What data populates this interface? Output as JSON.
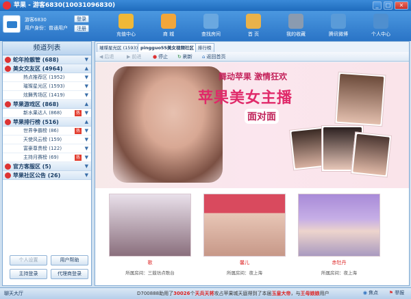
{
  "window": {
    "title": "苹果 - 游客6830(10031096830)"
  },
  "user": {
    "name": "游客6830",
    "identity": "用户身份：普通用户",
    "login_label": "登录",
    "register_label": "注册"
  },
  "nav": [
    {
      "label": "充值中心",
      "icon": "coin-icon",
      "color": "#f0b838"
    },
    {
      "label": "商 城",
      "icon": "cart-icon",
      "color": "#f2a63a"
    },
    {
      "label": "查找房间",
      "icon": "search-icon",
      "color": "#6aa8e0"
    },
    {
      "label": "首 页",
      "icon": "home-icon",
      "color": "#e9b24a"
    },
    {
      "label": "我的收藏",
      "icon": "star-icon",
      "color": "#8a9bb0"
    },
    {
      "label": "腾讯微博",
      "icon": "weibo-icon",
      "color": "#5a9bd8"
    },
    {
      "label": "个人中心",
      "icon": "person-icon",
      "color": "#4f8fcf"
    }
  ],
  "left": {
    "title": "频道列表",
    "categories": [
      {
        "label": "蛇年抢靓管 (688)",
        "subs": []
      },
      {
        "label": "美女交友区 (4964)",
        "subs": [
          {
            "label": "热点推荐区 (1952)"
          },
          {
            "label": "璀璨星光区 (1593)"
          },
          {
            "label": "炫舞秀场区 (1419)"
          }
        ]
      },
      {
        "label": "苹果游戏区 (868)",
        "subs": [
          {
            "label": "新水果达人 (868)",
            "hot": "热"
          }
        ]
      },
      {
        "label": "苹果排行榜 (516)",
        "subs": [
          {
            "label": "世界争霸榜 (86)",
            "hot": "热"
          },
          {
            "label": "天使风云榜 (159)"
          },
          {
            "label": "富豪尊贵榜 (122)"
          },
          {
            "label": "主持月赛榜 (69)",
            "hot": "热"
          }
        ]
      },
      {
        "label": "官方客服区 (5)",
        "subs": []
      },
      {
        "label": "苹果社区公告 (26)",
        "subs": []
      }
    ],
    "buttons": {
      "settings": "个人设置",
      "help": "用户帮助",
      "host_login": "主持登录",
      "agent_login": "代理商登录"
    }
  },
  "main": {
    "tabs": [
      {
        "label": "璀璨星光区 (1593)"
      },
      {
        "label": "pingguo55美女视频社区"
      },
      {
        "label": "排行榜"
      }
    ],
    "toolbar": {
      "back": "后退",
      "forward": "前进",
      "stop": "停止",
      "refresh": "刷新",
      "home": "返回首页"
    },
    "banner": {
      "slogan1": "舞动苹果  激情狂欢",
      "slogan2": "苹果美女主播",
      "slogan3": "面对面"
    },
    "cards": [
      {
        "name": "歌",
        "room": "所属房间：三鼓坊点歌台"
      },
      {
        "name": "馨儿",
        "room": "所属房间：夜上海"
      },
      {
        "name": "赤牡丹",
        "room": "所属房间：夜上海"
      }
    ]
  },
  "status": {
    "chat_label": "聊天大厅",
    "marquee_prefix": "D700888",
    "marquee_text1": "助用了",
    "marquee_num": "30026",
    "marquee_text2": "个",
    "marquee_hl1": "天兵天将",
    "marquee_text3": "攻占苹果城天庭得到了本届",
    "marquee_hl2": "玉皇大帝",
    "marquee_text4": "，与",
    "marquee_hl3": "王母娘娘",
    "marquee_text5": "用户",
    "focus": "焦点",
    "report": "举报"
  }
}
